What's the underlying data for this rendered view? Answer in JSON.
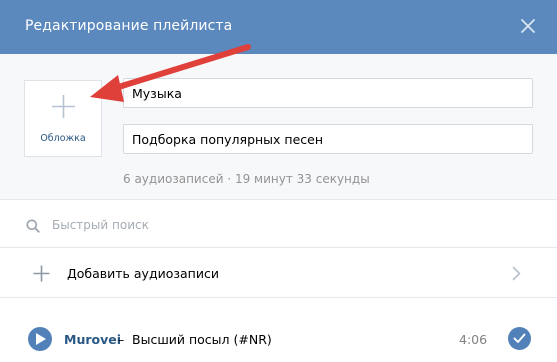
{
  "header": {
    "title": "Редактирование плейлиста",
    "close_icon": "close-icon"
  },
  "cover": {
    "label": "Обложка",
    "icon": "plus-icon"
  },
  "form": {
    "title_value": "Музыка",
    "description_value": "Подборка популярных песен"
  },
  "meta": {
    "text": "6 аудиозаписей · 19 минут 33 секунды"
  },
  "search": {
    "placeholder": "Быстрый поиск",
    "icon": "search-icon"
  },
  "add_audio": {
    "label": "Добавить аудиозаписи",
    "icon": "plus-icon",
    "chevron": "chevron-right-icon"
  },
  "tracks": [
    {
      "artist": "Murovei",
      "separator": "–",
      "title": "Высший посыл (#NR)",
      "duration": "4:06"
    }
  ],
  "colors": {
    "header_bg": "#5b88bd",
    "accent": "#5181b8",
    "link": "#2a5885",
    "annotation_arrow": "#e0403a"
  }
}
